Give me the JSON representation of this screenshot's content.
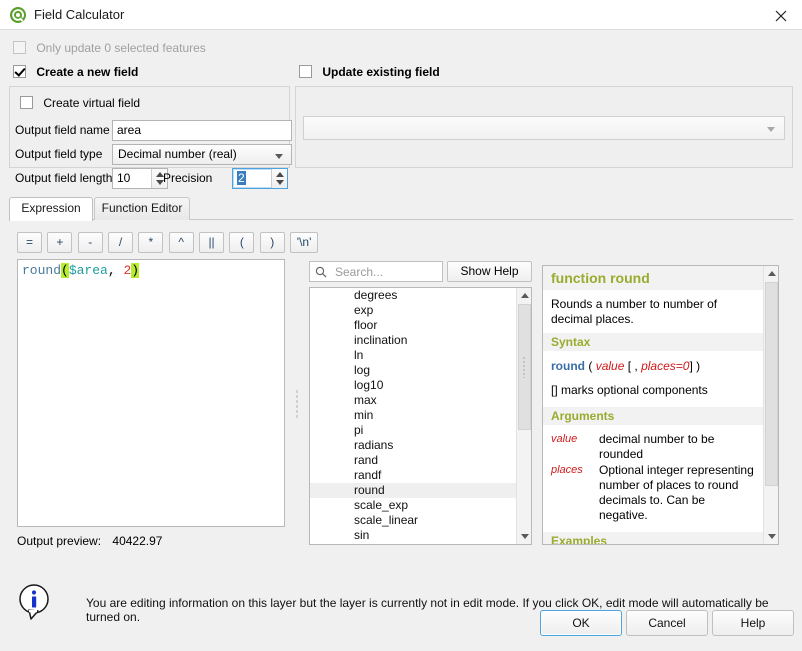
{
  "window": {
    "title": "Field Calculator",
    "icon": "qgis-logo-icon",
    "close_label": "×"
  },
  "options": {
    "only_update_selected": {
      "label": "Only update 0 selected features",
      "checked": false,
      "enabled": false
    },
    "create_new_field": {
      "label": "Create a new field",
      "checked": true
    },
    "update_existing_field": {
      "label": "Update existing field",
      "checked": false
    }
  },
  "new_field": {
    "virtual_label": "Create virtual field",
    "name_label": "Output field name",
    "name_value": "area",
    "type_label": "Output field type",
    "type_value": "Decimal number (real)",
    "length_label": "Output field length",
    "length_value": "10",
    "precision_label": "Precision",
    "precision_value": "2"
  },
  "existing_field": {
    "selected_value": ""
  },
  "tabs": [
    {
      "label": "Expression",
      "active": true
    },
    {
      "label": "Function Editor",
      "active": false
    }
  ],
  "operators": [
    "=",
    "+",
    "-",
    "/",
    "*",
    "^",
    "||",
    "(",
    ")",
    "'\\n'"
  ],
  "expression": {
    "tokens": [
      {
        "text": "round",
        "type": "function"
      },
      {
        "text": "(",
        "type": "paren-match"
      },
      {
        "text": "$area",
        "type": "variable"
      },
      {
        "text": ",",
        "type": "punctuation"
      },
      {
        "text": " ",
        "type": "space"
      },
      {
        "text": "2",
        "type": "number"
      },
      {
        "text": ")",
        "type": "paren-match"
      }
    ],
    "full_text": "round($area, 2)"
  },
  "preview": {
    "label": "Output preview:",
    "value": "40422.97"
  },
  "search": {
    "placeholder": "Search...",
    "value": ""
  },
  "show_help_label": "Show Help",
  "function_list": {
    "items": [
      "degrees",
      "exp",
      "floor",
      "inclination",
      "ln",
      "log",
      "log10",
      "max",
      "min",
      "pi",
      "radians",
      "rand",
      "randf",
      "round",
      "scale_exp",
      "scale_linear",
      "sin"
    ],
    "selected": "round"
  },
  "help": {
    "title": "function round",
    "description": "Rounds a number to number of decimal places.",
    "syntax_heading": "Syntax",
    "syntax": {
      "name": "round",
      "open": "(",
      "arg1": "value",
      "optional_open": "[",
      "comma": ",",
      "arg2": "places=0",
      "optional_close": "]",
      "close": ")"
    },
    "optional_note": "[] marks optional components",
    "arguments_heading": "Arguments",
    "arguments": [
      {
        "name": "value",
        "description": "decimal number to be rounded"
      },
      {
        "name": "places",
        "description": "Optional integer representing number of places to round decimals to. Can be negative."
      }
    ],
    "examples_heading": "Examples"
  },
  "footer": {
    "message": "You are editing information on this layer but the layer is currently not in edit mode. If you click OK, edit mode will automatically be turned on.",
    "icon": "info-icon"
  },
  "buttons": {
    "ok": "OK",
    "cancel": "Cancel",
    "help": "Help"
  },
  "colors": {
    "accent": "#4da3e0",
    "help_heading": "#9aab2e",
    "arg_red": "#d01a1a",
    "function_blue": "#3a6fa5",
    "paren_highlight": "#b8ec2f",
    "logo_green": "#5aa02c"
  }
}
